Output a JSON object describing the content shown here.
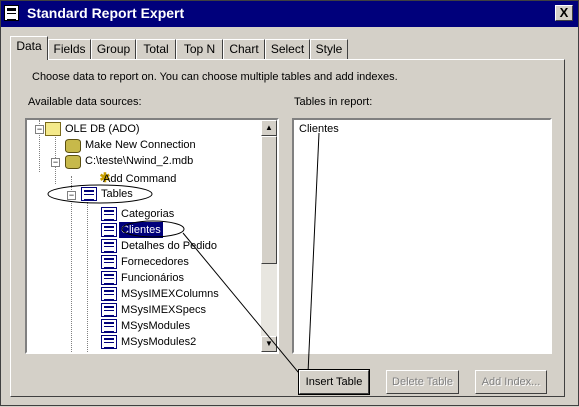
{
  "window": {
    "title": "Standard Report Expert",
    "close_label": "X"
  },
  "tabs": [
    {
      "label": "Data"
    },
    {
      "label": "Fields"
    },
    {
      "label": "Group"
    },
    {
      "label": "Total"
    },
    {
      "label": "Top N"
    },
    {
      "label": "Chart"
    },
    {
      "label": "Select"
    },
    {
      "label": "Style"
    }
  ],
  "instructions": "Choose data to report on. You can choose multiple tables and add indexes.",
  "available": {
    "label": "Available data sources:",
    "items": [
      {
        "label": "OLE DB (ADO)"
      },
      {
        "label": "Make New Connection"
      },
      {
        "label": "C:\\teste\\Nwind_2.mdb"
      },
      {
        "label": "Add Command"
      },
      {
        "label": "Tables"
      },
      {
        "label": "Categorias"
      },
      {
        "label": "Clientes"
      },
      {
        "label": "Detalhes do Pedido"
      },
      {
        "label": "Fornecedores"
      },
      {
        "label": "Funcionários"
      },
      {
        "label": "MSysIMEXColumns"
      },
      {
        "label": "MSysIMEXSpecs"
      },
      {
        "label": "MSysModules"
      },
      {
        "label": "MSysModules2"
      }
    ]
  },
  "report_tables": {
    "label": "Tables in report:",
    "items": [
      {
        "label": "Clientes"
      }
    ]
  },
  "buttons": {
    "insert_table": "Insert Table",
    "delete_table": "Delete Table",
    "add_index": "Add Index..."
  },
  "scroll": {
    "up_glyph": "▲",
    "down_glyph": "▼"
  },
  "tree_glyphs": {
    "collapse": "−",
    "star": "✱"
  }
}
